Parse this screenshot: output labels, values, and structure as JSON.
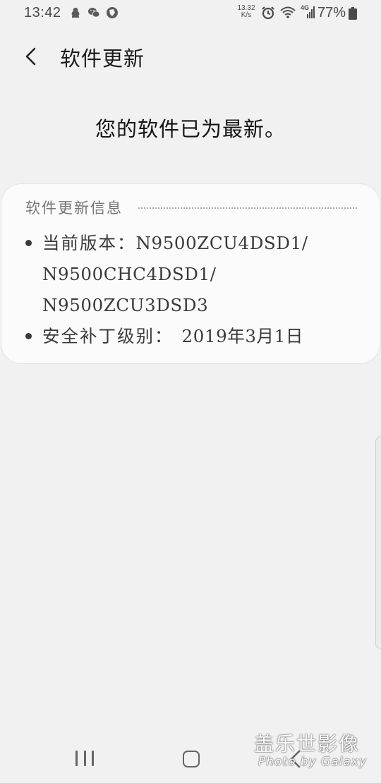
{
  "status_bar": {
    "time": "13:42",
    "net_speed_value": "13.32",
    "net_speed_unit": "K/s",
    "network_type": "4G",
    "battery": "77%",
    "left_icons": [
      "app-notification-icon",
      "wechat-icon",
      "browser-icon"
    ],
    "right_icons": [
      "alarm-icon",
      "wifi-icon",
      "signal-icon",
      "battery-icon"
    ]
  },
  "header": {
    "title": "软件更新"
  },
  "main": {
    "message": "您的软件已为最新。"
  },
  "info_card": {
    "title": "软件更新信息",
    "items": [
      {
        "label": "当前版本：",
        "value_line1": "N9500ZCU4DSD1/",
        "value_line2": "N9500CHC4DSD1/",
        "value_line3": "N9500ZCU3DSD3"
      },
      {
        "label": "安全补丁级别：",
        "value": "2019年3月1日"
      }
    ]
  },
  "watermark": {
    "line1": "盖乐世影像",
    "line2": "Photo by Galaxy"
  },
  "colors": {
    "background": "#f1f1f1",
    "card": "#fbfbfb",
    "text_primary": "#141414",
    "text_secondary": "#777777"
  }
}
